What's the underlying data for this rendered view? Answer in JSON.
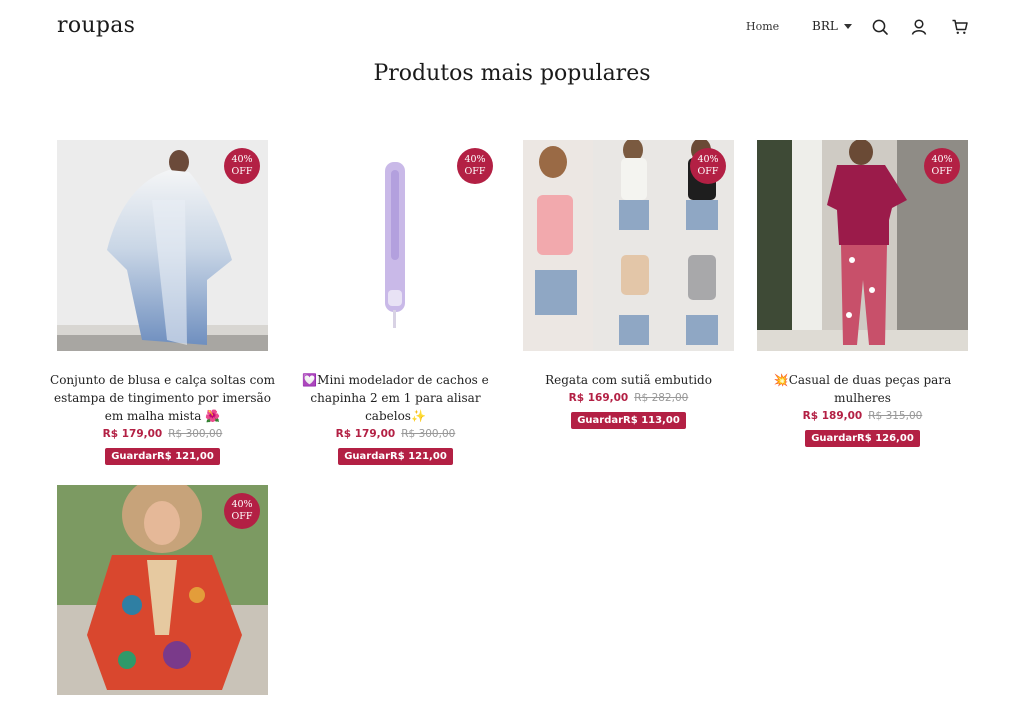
{
  "header": {
    "logo": "roupas",
    "nav_home": "Home",
    "currency": "BRL"
  },
  "icons": [
    "search-icon",
    "user-icon",
    "cart-icon",
    "chevron-down-icon"
  ],
  "colors": {
    "accent": "#b32044",
    "old_price": "#999999",
    "text": "#1d1d1d"
  },
  "section": {
    "title": "Produtos mais populares"
  },
  "products": [
    {
      "badge_pct": "40%",
      "badge_off": "OFF",
      "name": "Conjunto de blusa e calça soltas com estampa de tingimento por imersão em malha mista 🌺",
      "price": "R$ 179,00",
      "old_price": "R$ 300,00",
      "save": "GuardarR$ 121,00"
    },
    {
      "badge_pct": "40%",
      "badge_off": "OFF",
      "name": "💟Mini modelador de cachos e chapinha 2 em 1 para alisar cabelos✨",
      "price": "R$ 179,00",
      "old_price": "R$ 300,00",
      "save": "GuardarR$ 121,00"
    },
    {
      "badge_pct": "40%",
      "badge_off": "OFF",
      "name": "Regata com sutiã embutido",
      "price": "R$ 169,00",
      "old_price": "R$ 282,00",
      "save": "GuardarR$ 113,00"
    },
    {
      "badge_pct": "40%",
      "badge_off": "OFF",
      "name": "💥Casual de duas peças para mulheres",
      "price": "R$ 189,00",
      "old_price": "R$ 315,00",
      "save": "GuardarR$ 126,00"
    },
    {
      "badge_pct": "40%",
      "badge_off": "OFF",
      "name": "",
      "price": "",
      "old_price": "",
      "save": ""
    }
  ]
}
